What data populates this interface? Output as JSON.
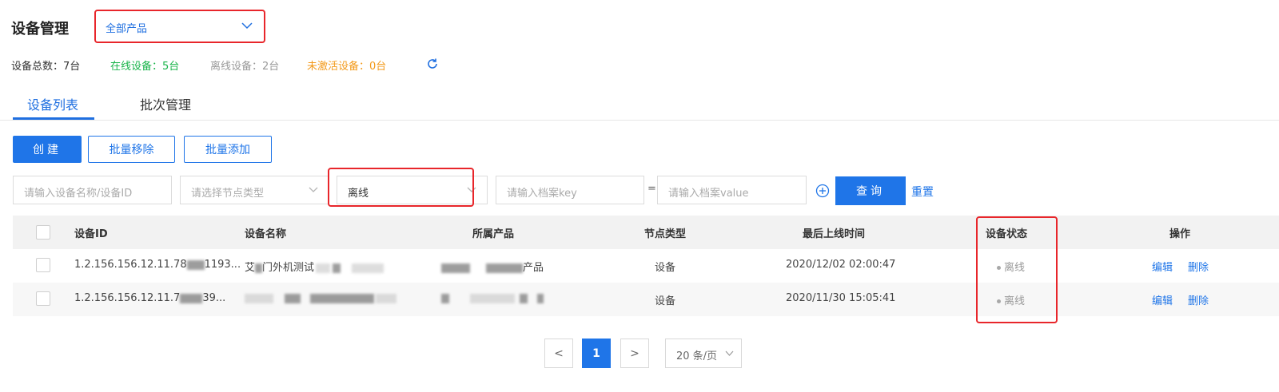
{
  "header": {
    "title": "设备管理",
    "product_select": "全部产品"
  },
  "stats": {
    "total": "设备总数：7台",
    "online": "在线设备：5台",
    "offline": "离线设备：2台",
    "inactive": "未激活设备：0台"
  },
  "tabs": [
    {
      "label": "设备列表",
      "active": true
    },
    {
      "label": "批次管理",
      "active": false
    }
  ],
  "toolbar": {
    "create": "创建",
    "batch_remove": "批量移除",
    "batch_add": "批量添加"
  },
  "filters": {
    "name_placeholder": "请输入设备名称/设备ID",
    "node_type_placeholder": "请选择节点类型",
    "status_value": "离线",
    "key_placeholder": "请输入档案key",
    "equals": "=",
    "value_placeholder": "请输入档案value",
    "query": "查询",
    "reset": "重置"
  },
  "table": {
    "columns": [
      "设备ID",
      "设备名称",
      "所属产品",
      "节点类型",
      "最后上线时间",
      "设备状态",
      "操作"
    ],
    "rows": [
      {
        "id_prefix": "1.2.156.156.12.11.78",
        "id_suffix": "1193...",
        "name_start": "艾",
        "name_mid": "门外机测试",
        "product_end": "产品",
        "node_type": "设备",
        "last_online": "2020/12/02 02:00:47",
        "status": "离线",
        "edit": "编辑",
        "delete": "删除"
      },
      {
        "id_prefix": "1.2.156.156.12.11.7",
        "id_suffix": "39...",
        "name_start": "",
        "name_mid": "",
        "product_end": "",
        "node_type": "设备",
        "last_online": "2020/11/30 15:05:41",
        "status": "离线",
        "edit": "编辑",
        "delete": "删除"
      }
    ]
  },
  "pagination": {
    "prev": "<",
    "current": "1",
    "next": ">",
    "page_size": "20 条/页"
  },
  "colors": {
    "primary": "#1f75e8",
    "online": "#19b44a",
    "inactive": "#f39a1b",
    "highlight": "#e8262b"
  }
}
